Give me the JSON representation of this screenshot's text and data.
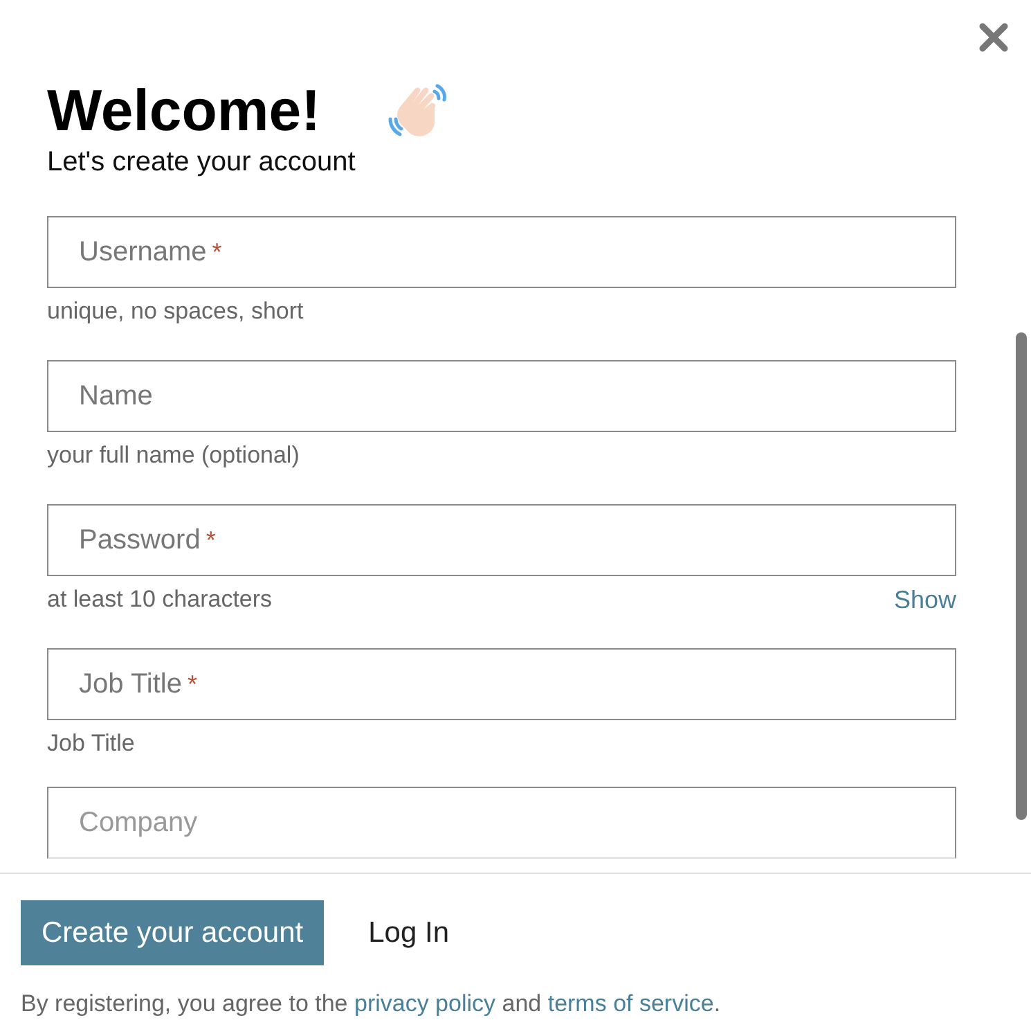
{
  "header": {
    "title": "Welcome!",
    "subtitle": "Let's create your account"
  },
  "fields": [
    {
      "placeholder": "Username",
      "required_mark": "*",
      "hint": "unique, no spaces, short"
    },
    {
      "placeholder": "Name",
      "hint": "your full name (optional)"
    },
    {
      "placeholder": "Password",
      "required_mark": "*",
      "hint": "at least 10 characters",
      "toggle": "Show"
    },
    {
      "placeholder": "Job Title",
      "required_mark": "*",
      "hint": "Job Title"
    },
    {
      "placeholder": "Company"
    }
  ],
  "footer": {
    "primary_button": "Create your account",
    "secondary_button": "Log In",
    "legal": {
      "before": "By registering, you agree to the ",
      "privacy_link": "privacy policy",
      "middle": " and ",
      "terms_link": "terms of service",
      "after": "."
    }
  }
}
